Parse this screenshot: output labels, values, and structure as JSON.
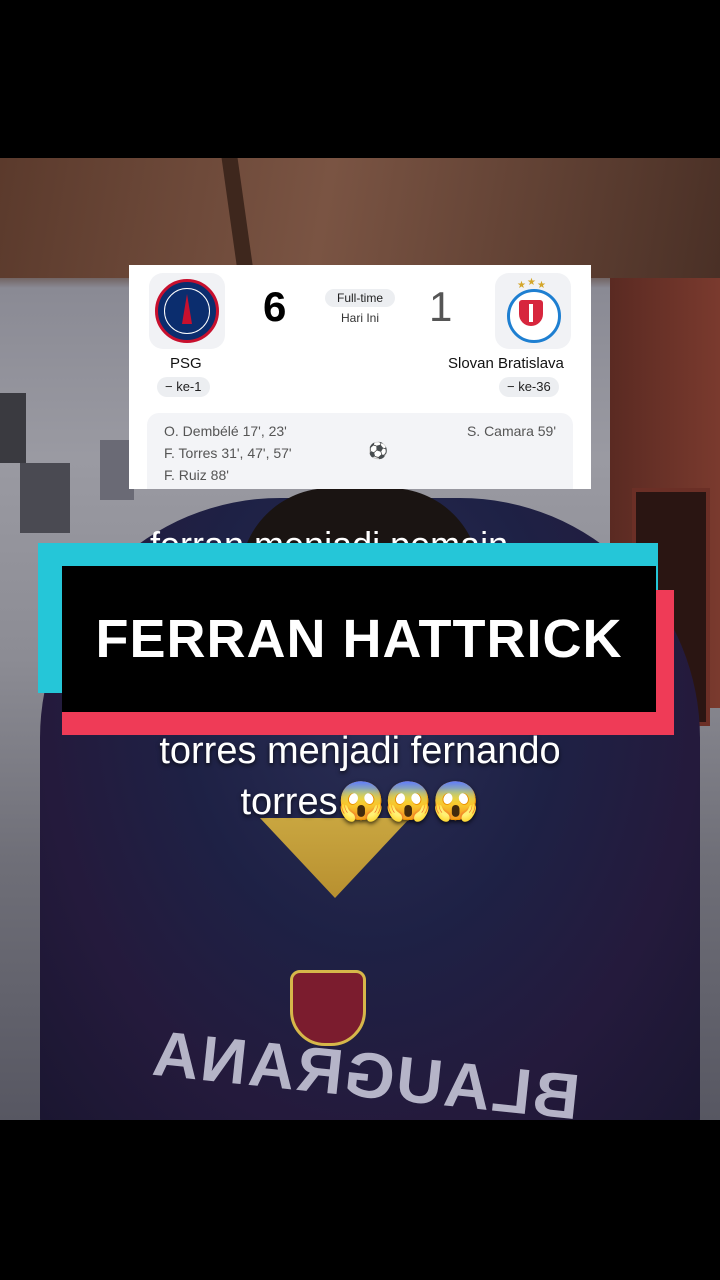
{
  "scoreboard": {
    "home": {
      "name": "PSG",
      "score": "6",
      "rank": "− ke-1"
    },
    "away": {
      "name": "Slovan Bratislava",
      "score": "1",
      "rank": "− ke-36"
    },
    "status": "Full-time",
    "date": "Hari Ini",
    "home_scorers": [
      "O. Dembélé 17', 23'",
      "F. Torres 31', 47', 57'",
      "F. Ruiz 88'"
    ],
    "away_scorers": [
      "S. Camara 59'"
    ],
    "goal_icon": "soccer-ball-icon"
  },
  "caption": {
    "headline": "FERRAN HATTRICK",
    "hidden_line": "ferran menjadi pemain",
    "line1": "torres menjadi fernando",
    "line2": "torres😱😱😱"
  },
  "colors": {
    "cyan": "#25c6d8",
    "red": "#ef3b57",
    "psg_blue": "#0b2d6e"
  }
}
